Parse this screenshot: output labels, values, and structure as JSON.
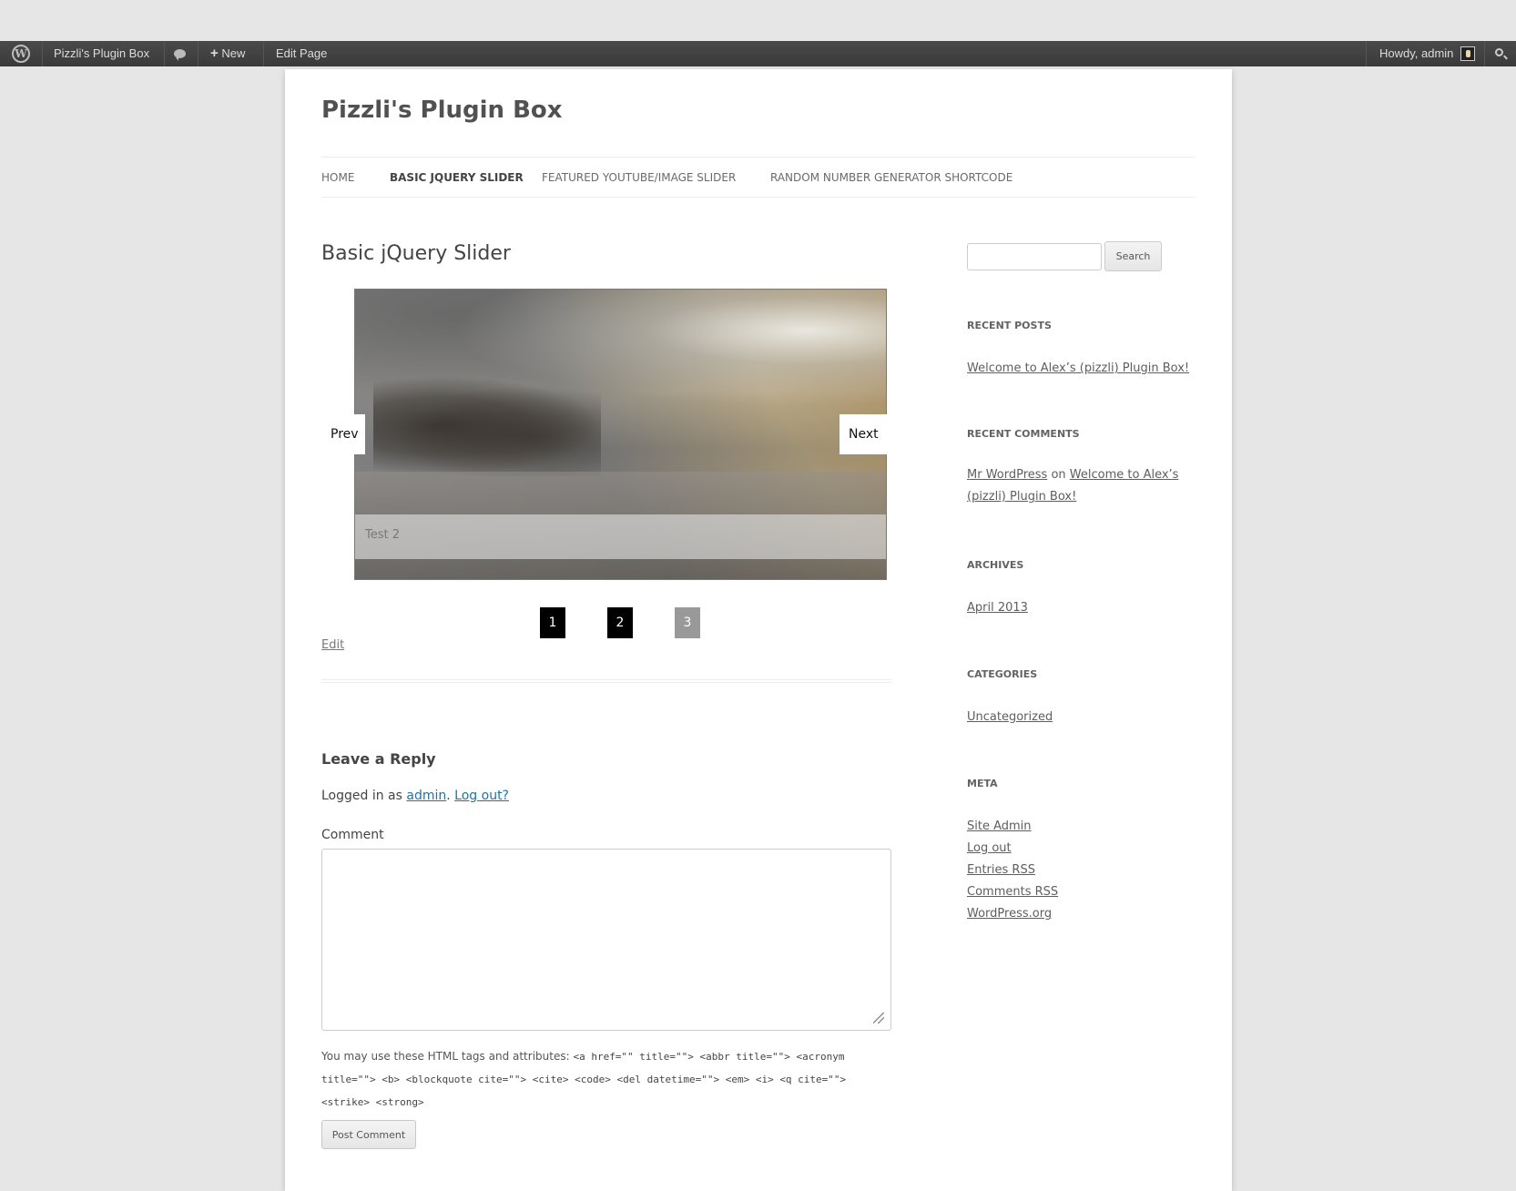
{
  "adminbar": {
    "site_name": "Pizzli's Plugin Box",
    "new_label": "New",
    "new_icon": "+",
    "edit_page": "Edit Page",
    "howdy": "Howdy, admin",
    "wp_logo_glyph": "W"
  },
  "site": {
    "title": "Pizzli's Plugin Box"
  },
  "nav": {
    "items": [
      {
        "label": "HOME"
      },
      {
        "label": "BASIC JQUERY SLIDER"
      },
      {
        "label": "FEATURED YOUTUBE/IMAGE SLIDER"
      },
      {
        "label": "RANDOM NUMBER GENERATOR SHORTCODE"
      }
    ]
  },
  "entry": {
    "title": "Basic jQuery Slider",
    "edit": "Edit"
  },
  "slider": {
    "caption": "Test 2",
    "prev": "Prev",
    "next": "Next",
    "pages": [
      "1",
      "2",
      "3"
    ],
    "active_page": 3
  },
  "comments": {
    "title": "Leave a Reply",
    "logged_in_prefix": "Logged in as ",
    "user": "admin",
    "period": ".",
    "logout": "Log out?",
    "comment_label": "Comment",
    "allowed_prefix": "You may use these HTML tags and attributes: ",
    "allowed_tags": "<a href=\"\" title=\"\"> <abbr title=\"\"> <acronym title=\"\"> <b> <blockquote cite=\"\"> <cite> <code> <del datetime=\"\"> <em> <i> <q cite=\"\"> <strike> <strong>",
    "post_button": "Post Comment"
  },
  "sidebar": {
    "search_button": "Search",
    "recent_posts_title": "RECENT POSTS",
    "recent_post": "Welcome to Alex’s (pizzli) Plugin Box!",
    "recent_comments_title": "RECENT COMMENTS",
    "comment_author": "Mr WordPress",
    "comment_on": " on ",
    "comment_post": "Welcome to Alex’s (pizzli) Plugin Box!",
    "archives_title": "ARCHIVES",
    "archive": "April 2013",
    "categories_title": "CATEGORIES",
    "category": "Uncategorized",
    "meta_title": "META",
    "meta_links": [
      "Site Admin",
      "Log out",
      "Entries RSS",
      "Comments RSS",
      "WordPress.org"
    ]
  },
  "colors": {
    "adminbar_bg": "#464646",
    "link_blue": "#21759b",
    "pager_active": "#999999"
  }
}
